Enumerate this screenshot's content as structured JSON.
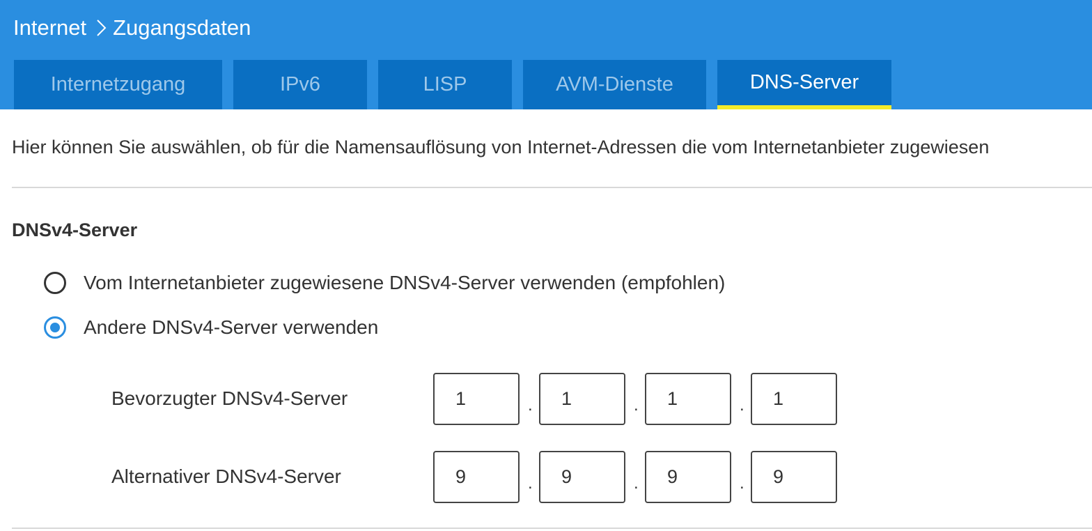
{
  "breadcrumb": {
    "section": "Internet",
    "page": "Zugangsdaten",
    "separator_icon": "chevron-right-icon"
  },
  "tabs": [
    {
      "label": "Internetzugang",
      "active": false
    },
    {
      "label": "IPv6",
      "active": false
    },
    {
      "label": "LISP",
      "active": false
    },
    {
      "label": "AVM-Dienste",
      "active": false
    },
    {
      "label": "DNS-Server",
      "active": true
    }
  ],
  "description": "Hier können Sie auswählen, ob für die Namensauflösung von Internet-Adressen die vom Internetanbieter zugewiesen",
  "dnsv4": {
    "title": "DNSv4-Server",
    "options": [
      {
        "label": "Vom Internetanbieter zugewiesene DNSv4-Server verwenden (empfohlen)",
        "checked": false
      },
      {
        "label": "Andere DNSv4-Server verwenden",
        "checked": true
      }
    ],
    "preferred": {
      "label": "Bevorzugter DNSv4-Server",
      "octets": [
        "1",
        "1",
        "1",
        "1"
      ]
    },
    "alternative": {
      "label": "Alternativer DNSv4-Server",
      "octets": [
        "9",
        "9",
        "9",
        "9"
      ]
    },
    "octet_separator": "."
  },
  "colors": {
    "header_bg": "#2a8ee0",
    "tab_bg": "#0a6fc2",
    "tab_active_underline": "#f4ea2a",
    "radio_checked": "#2a8ee0"
  }
}
